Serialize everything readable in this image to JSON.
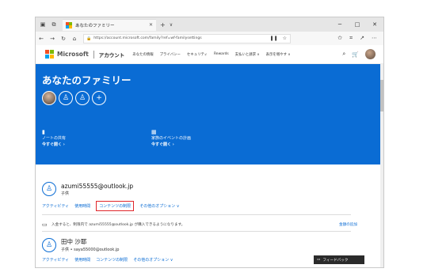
{
  "browser": {
    "tab_title": "あなたのファミリー",
    "close_glyph": "✕",
    "new_tab_glyph": "+",
    "tab_menu_glyph": "∨",
    "win_min": "─",
    "win_max": "□",
    "win_close": "✕",
    "back": "←",
    "forward": "→",
    "refresh": "↻",
    "home": "⌂",
    "url": "https://account.microsoft.com/family?ref=wf-familysettings",
    "lock_glyph": "🔒",
    "reading_glyph": "❚❚",
    "favorite_glyph": "☆",
    "favorites_glyph": "✩",
    "collections_glyph": "⌗",
    "share_glyph": "↗",
    "more_glyph": "⋯",
    "colors": {
      "red": "#f25022",
      "green": "#7fba00",
      "blue": "#00a4ef",
      "yellow": "#ffb900"
    }
  },
  "header": {
    "brand": "Microsoft",
    "account_label": "アカウント",
    "nav": [
      "あなたの情報",
      "プライバシー",
      "セキュリティ",
      "Rewards",
      "支払いと請求 ∨",
      "表示を増やす ∨"
    ],
    "search_glyph": "⌕",
    "cart_glyph": "🛒"
  },
  "hero": {
    "title": "あなたのファミリー",
    "accent": "#0a6cd4",
    "features": [
      {
        "icon": "▮",
        "name": "ノートの共有",
        "action": "今すぐ開く ›"
      },
      {
        "icon": "▦",
        "name": "家族のイベントの計画",
        "action": "今すぐ開く ›"
      }
    ],
    "add_glyph": "+",
    "person_glyph": "♙"
  },
  "members": [
    {
      "email": "azumi55555@outlook.jp",
      "role": "子供",
      "tabs": [
        "アクティビティ",
        "使用時間",
        "コンテンツの制限",
        "その他のオプション ∨"
      ],
      "selected_tab": "コンテンツの制限",
      "notice": "入金すると、制限内で azumi55555@outlook.jp が購入できるようになります。",
      "notice_link": "金額の追加"
    },
    {
      "name": "田中 沙耶",
      "role": "子供 • saya55000@outlook.jp",
      "tabs": [
        "アクティビティ",
        "使用時間",
        "コンテンツの制限",
        "その他のオプション ∨"
      ]
    }
  ],
  "feedback": {
    "label": "フィードバック",
    "icon_glyph": "▭"
  }
}
